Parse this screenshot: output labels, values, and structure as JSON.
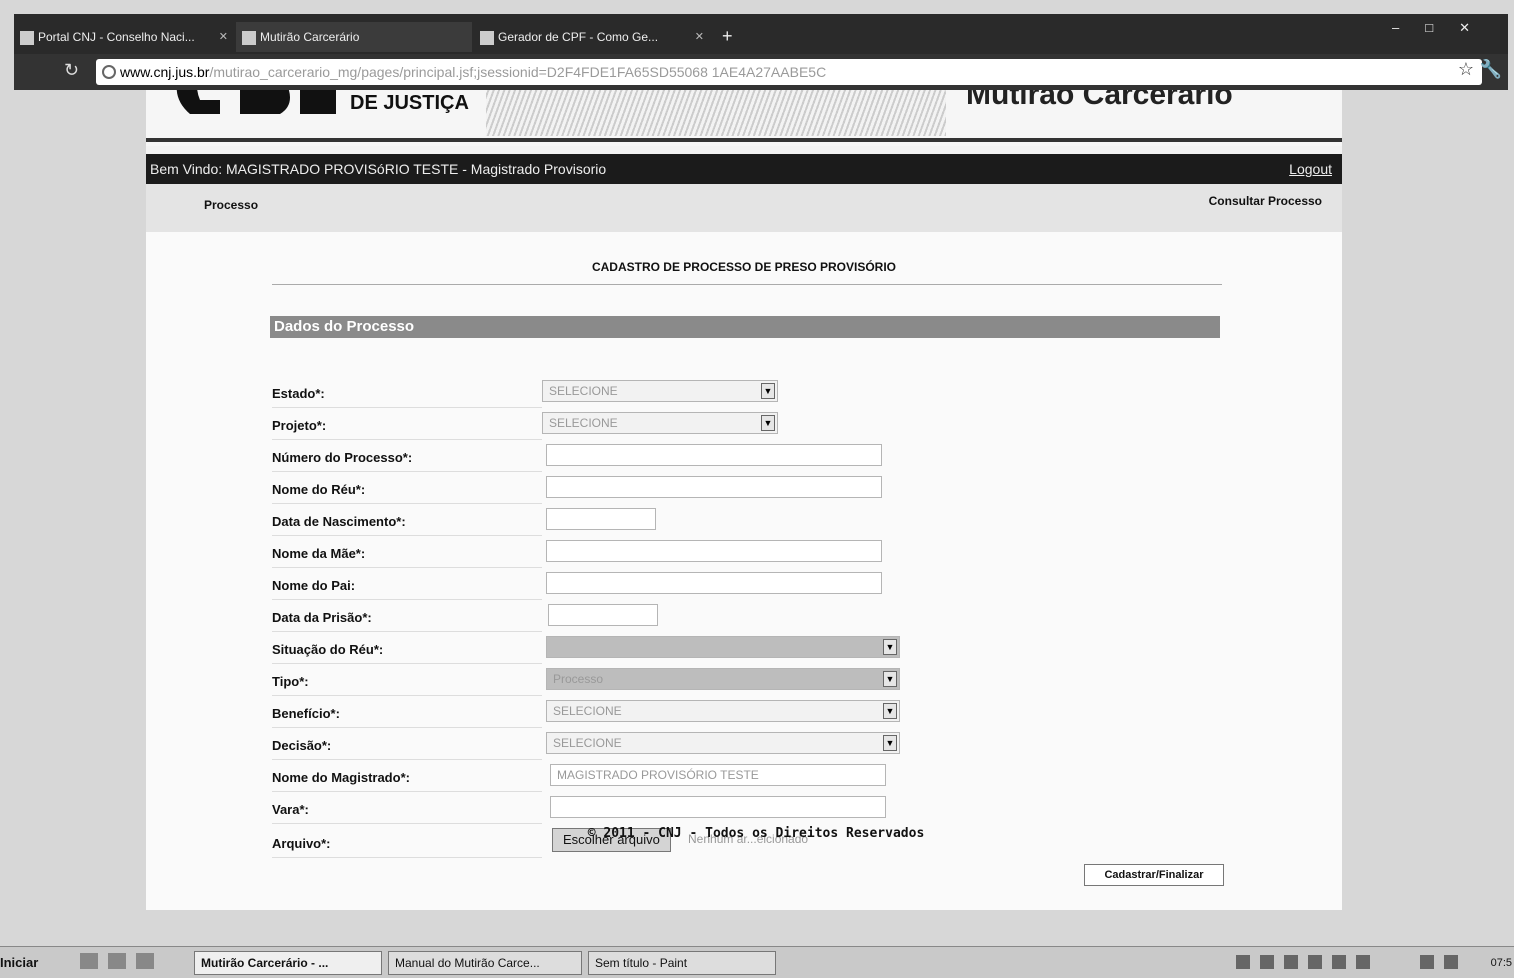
{
  "browser": {
    "tabs": [
      {
        "label": "Portal CNJ - Conselho Naci..."
      },
      {
        "label": "Mutirão Carcerário"
      },
      {
        "label": "Gerador de CPF - Como Ge..."
      }
    ],
    "url_host": "www.cnj.jus.br",
    "url_path": "/mutirao_carcerario_mg/pages/principal.jsf;jsessionid=D2F4FDE1FA65SD55068 1AE4A27AABE5C"
  },
  "header": {
    "logo_text": "DE JUSTIÇA",
    "system_title": "Mutirão Carcerário"
  },
  "welcome": {
    "text": "Bem Vindo: MAGISTRADO PROVISóRIO TESTE - Magistrado Provisorio",
    "logout_label": "Logout"
  },
  "menu": {
    "left_label": "Processo",
    "right_label": "Consultar Processo"
  },
  "form": {
    "title": "CADASTRO DE PROCESSO DE PRESO PROVISÓRIO",
    "section_title": "Dados do Processo",
    "fields": {
      "estado": {
        "label": "Estado*:",
        "value": "SELECIONE"
      },
      "projeto": {
        "label": "Projeto*:",
        "value": "SELECIONE"
      },
      "numero": {
        "label": "Número do Processo*:",
        "value": ""
      },
      "nome_reu": {
        "label": "Nome do Réu*:",
        "value": ""
      },
      "data_nasc": {
        "label": "Data de Nascimento*:",
        "value": ""
      },
      "nome_mae": {
        "label": "Nome da Mãe*:",
        "value": ""
      },
      "nome_pai": {
        "label": "Nome do Pai:",
        "value": ""
      },
      "data_prisao": {
        "label": "Data da Prisão*:",
        "value": ""
      },
      "situacao": {
        "label": "Situação do Réu*:",
        "value": ""
      },
      "tipo": {
        "label": "Tipo*:",
        "value": "Processo"
      },
      "beneficio": {
        "label": "Benefício*:",
        "value": "SELECIONE"
      },
      "decisao": {
        "label": "Decisão*:",
        "value": "SELECIONE"
      },
      "magistrado": {
        "label": "Nome do Magistrado*:",
        "value": "MAGISTRADO PROVISÓRIO TESTE"
      },
      "vara": {
        "label": "Vara*:",
        "value": ""
      },
      "arquivo": {
        "label": "Arquivo*:",
        "button_label": "Escolher arquivo",
        "status": "Nenhum ar...elcionado"
      }
    },
    "submit_label": "Cadastrar/Finalizar"
  },
  "footer": {
    "text": "© 2011 - CNJ - Todos os Direitos Reservados"
  },
  "taskbar": {
    "start_label": "Iniciar",
    "tasks": [
      {
        "label": "Mutirão Carcerário - ..."
      },
      {
        "label": "Manual do Mutirão Carce..."
      },
      {
        "label": "Sem título - Paint"
      }
    ],
    "clock": "07:5"
  }
}
